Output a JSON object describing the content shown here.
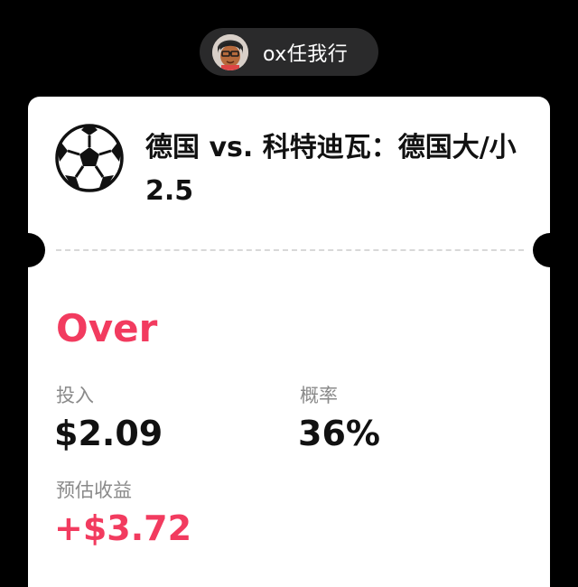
{
  "user": {
    "username": "ox任我行",
    "avatar_icon": "avatar-cartoon-icon"
  },
  "bet": {
    "match_title": "德国 vs. 科特迪瓦：德国大/小 2.5",
    "sport_icon": "soccer-ball-icon",
    "selection": "Over",
    "stake_label": "投入",
    "stake_value": "$2.09",
    "probability_label": "概率",
    "probability_value": "36%",
    "payout_label": "预估收益",
    "payout_value": "+$3.72"
  },
  "colors": {
    "accent": "#f23b5f",
    "background": "#000000",
    "card": "#ffffff",
    "pill": "#2a2a2b"
  }
}
